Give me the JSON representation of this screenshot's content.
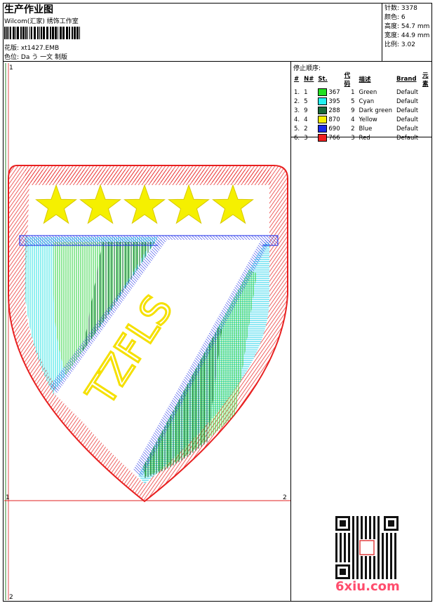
{
  "header": {
    "title": "生产作业图",
    "company": "Wilcom(汇家) 绣饰工作室",
    "pattern_label": "花版:",
    "pattern_value": "xt1427.EMB",
    "color_label": "色位:",
    "color_value": "Da う 一文 制版"
  },
  "specs": [
    {
      "label": "针数:",
      "value": "3378"
    },
    {
      "label": "颜色:",
      "value": "6"
    },
    {
      "label": "高度:",
      "value": "54.7 mm"
    },
    {
      "label": "宽度:",
      "value": "44.9 mm"
    },
    {
      "label": "比例:",
      "value": "3.02"
    }
  ],
  "stop_sequence": {
    "label": "停止顺序:",
    "headers": [
      "#",
      "N#",
      "St.",
      "代码",
      "描述",
      "Brand",
      "元素"
    ],
    "rows": [
      {
        "idx": "1.",
        "n": "1",
        "stitches": "367",
        "code": "1",
        "desc": "Green",
        "brand": "Default",
        "color": "#22e022"
      },
      {
        "idx": "2.",
        "n": "5",
        "stitches": "395",
        "code": "5",
        "desc": "Cyan",
        "brand": "Default",
        "color": "#22f0f0"
      },
      {
        "idx": "3.",
        "n": "9",
        "stitches": "288",
        "code": "9",
        "desc": "Dark green",
        "brand": "Default",
        "color": "#1a6a3a"
      },
      {
        "idx": "4.",
        "n": "4",
        "stitches": "870",
        "code": "4",
        "desc": "Yellow",
        "brand": "Default",
        "color": "#f5f000"
      },
      {
        "idx": "5.",
        "n": "2",
        "stitches": "690",
        "code": "2",
        "desc": "Blue",
        "brand": "Default",
        "color": "#1a2ae8"
      },
      {
        "idx": "6.",
        "n": "3",
        "stitches": "766",
        "code": "3",
        "desc": "Red",
        "brand": "Default",
        "color": "#f02020"
      }
    ]
  },
  "design": {
    "badge_text": "TZFLS",
    "guide_marks": [
      "1",
      "2",
      "1",
      "2"
    ]
  },
  "watermark": "6xiu.com"
}
